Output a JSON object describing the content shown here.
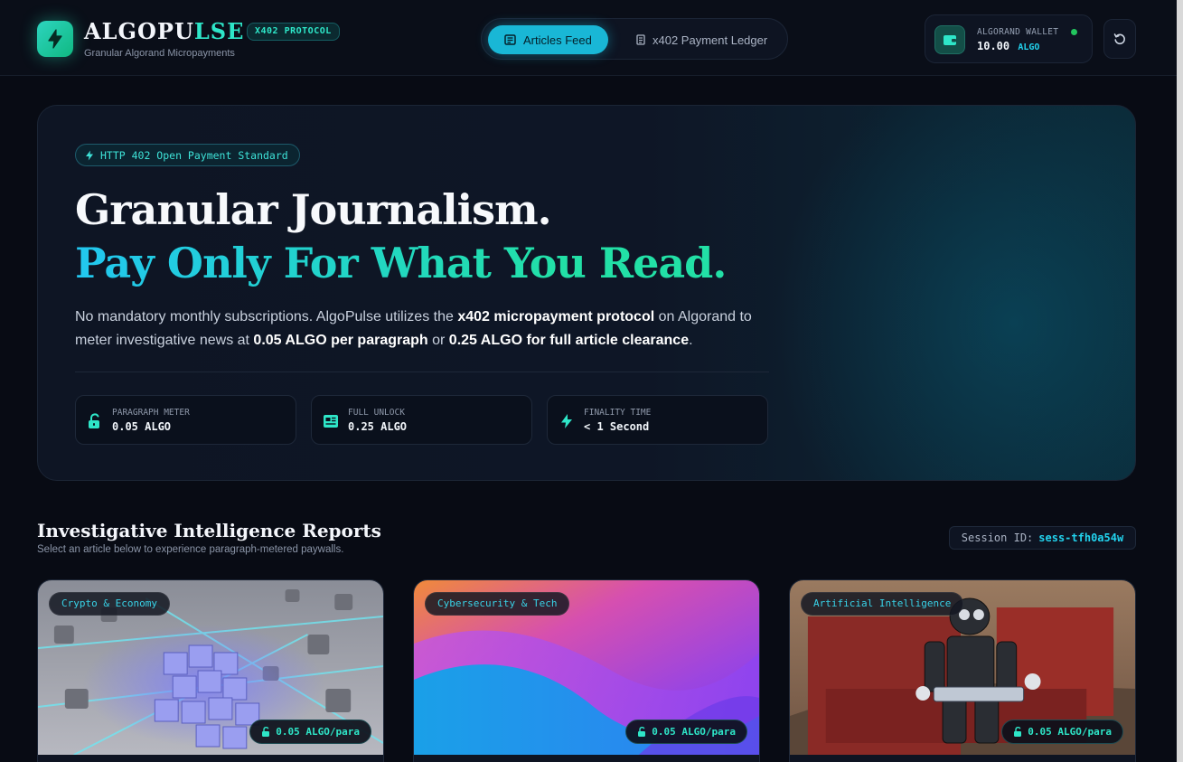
{
  "header": {
    "brand_main": "ALGOPU",
    "brand_accent": "LSE",
    "protocol_badge": "X402 PROTOCOL",
    "tagline": "Granular Algorand Micropayments",
    "logo_icon": "lightning-icon",
    "nav": [
      {
        "label": "Articles Feed",
        "icon": "newspaper-icon",
        "active": true
      },
      {
        "label": "x402 Payment Ledger",
        "icon": "ledger-icon",
        "active": false
      }
    ],
    "wallet": {
      "label": "ALGORAND WALLET",
      "balance": "10.00",
      "unit": "ALGO",
      "status_color": "#22c55e"
    },
    "reset_icon": "refresh-icon"
  },
  "hero": {
    "badge": "HTTP 402 Open Payment Standard",
    "title_line1": "Granular Journalism.",
    "title_line2": "Pay Only For What You Read.",
    "desc_part1": "No mandatory monthly subscriptions. AlgoPulse utilizes the ",
    "desc_bold1": "x402 micropayment protocol",
    "desc_part2": " on Algorand to meter investigative news at ",
    "desc_bold2": "0.05 ALGO per paragraph",
    "desc_part3": " or ",
    "desc_bold3": "0.25 ALGO for full article clearance",
    "desc_part4": ".",
    "stats": [
      {
        "label": "PARAGRAPH METER",
        "value": "0.05 ALGO",
        "icon": "lock-open-icon"
      },
      {
        "label": "FULL UNLOCK",
        "value": "0.25 ALGO",
        "icon": "newspaper-icon"
      },
      {
        "label": "FINALITY TIME",
        "value": "< 1 Second",
        "icon": "lightning-icon"
      }
    ]
  },
  "section": {
    "title": "Investigative Intelligence Reports",
    "subtitle": "Select an article below to experience paragraph-metered paywalls.",
    "session_label": "Session ID:",
    "session_id": "sess-tfh0a54w"
  },
  "articles": [
    {
      "category": "Crypto & Economy",
      "price": "0.05 ALGO/para"
    },
    {
      "category": "Cybersecurity & Tech",
      "price": "0.05 ALGO/para"
    },
    {
      "category": "Artificial Intelligence",
      "price": "0.05 ALGO/para"
    }
  ],
  "colors": {
    "accent_cyan": "#19b7d6",
    "accent_teal": "#2ee6c8",
    "background": "#080b14"
  }
}
